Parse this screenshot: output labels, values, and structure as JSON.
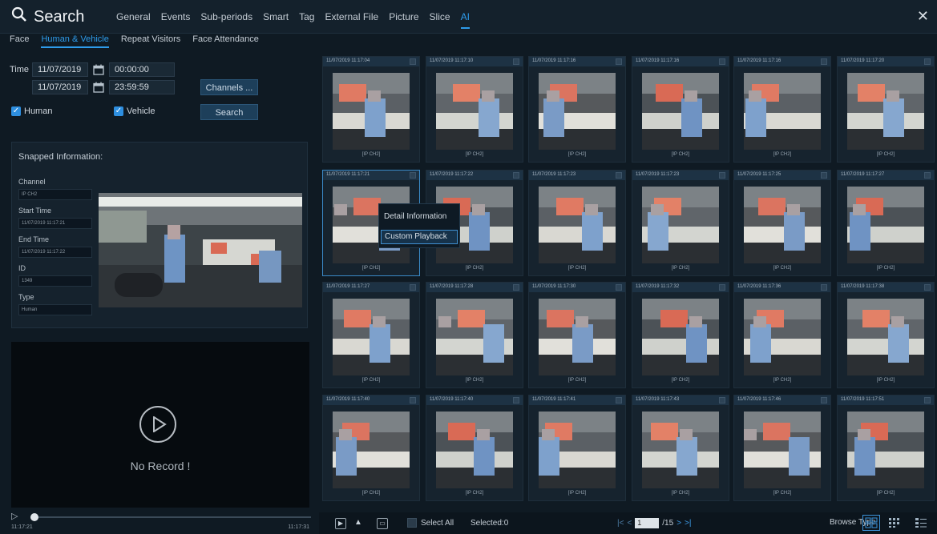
{
  "header": {
    "title": "Search",
    "tabs": [
      "General",
      "Events",
      "Sub-periods",
      "Smart",
      "Tag",
      "External File",
      "Picture",
      "Slice",
      "AI"
    ],
    "active_tab": "AI"
  },
  "subtabs": {
    "items": [
      "Face",
      "Human & Vehicle",
      "Repeat Visitors",
      "Face Attendance"
    ],
    "active": "Human & Vehicle"
  },
  "filters": {
    "time_label": "Time",
    "start_date": "11/07/2019",
    "start_time": "00:00:00",
    "end_date": "11/07/2019",
    "end_time": "23:59:59",
    "channels_label": "Channels ...",
    "human_label": "Human",
    "vehicle_label": "Vehicle",
    "search_label": "Search"
  },
  "snapped": {
    "title": "Snapped Information:",
    "channel_label": "Channel",
    "channel_value": "IP CH2",
    "start_label": "Start Time",
    "start_value": "11/07/2019 11:17:21",
    "end_label": "End Time",
    "end_value": "11/07/2019 11:17:22",
    "id_label": "ID",
    "id_value": "1349",
    "type_label": "Type",
    "type_value": "Human"
  },
  "player": {
    "no_record": "No Record !",
    "start_time": "11:17:21",
    "end_time": "11:17:31"
  },
  "thumbnails": [
    {
      "ts": "11/07/2019 11:17:04",
      "ch": "[IP CH2]"
    },
    {
      "ts": "11/07/2019 11:17:10",
      "ch": "[IP CH2]"
    },
    {
      "ts": "11/07/2019 11:17:16",
      "ch": "[IP CH2]"
    },
    {
      "ts": "11/07/2019 11:17:16",
      "ch": "[IP CH2]"
    },
    {
      "ts": "11/07/2019 11:17:16",
      "ch": "[IP CH2]"
    },
    {
      "ts": "11/07/2019 11:17:20",
      "ch": "[IP CH2]"
    },
    {
      "ts": "11/07/2019 11:17:21",
      "ch": "[IP CH2]"
    },
    {
      "ts": "11/07/2019 11:17:22",
      "ch": "[IP CH2]"
    },
    {
      "ts": "11/07/2019 11:17:23",
      "ch": "[IP CH2]"
    },
    {
      "ts": "11/07/2019 11:17:23",
      "ch": "[IP CH2]"
    },
    {
      "ts": "11/07/2019 11:17:25",
      "ch": "[IP CH2]"
    },
    {
      "ts": "11/07/2019 11:17:27",
      "ch": "[IP CH2]"
    },
    {
      "ts": "11/07/2019 11:17:27",
      "ch": "[IP CH2]"
    },
    {
      "ts": "11/07/2019 11:17:28",
      "ch": "[IP CH2]"
    },
    {
      "ts": "11/07/2019 11:17:30",
      "ch": "[IP CH2]"
    },
    {
      "ts": "11/07/2019 11:17:32",
      "ch": "[IP CH2]"
    },
    {
      "ts": "11/07/2019 11:17:36",
      "ch": "[IP CH2]"
    },
    {
      "ts": "11/07/2019 11:17:38",
      "ch": "[IP CH2]"
    },
    {
      "ts": "11/07/2019 11:17:40",
      "ch": "[IP CH2]"
    },
    {
      "ts": "11/07/2019 11:17:40",
      "ch": "[IP CH2]"
    },
    {
      "ts": "11/07/2019 11:17:41",
      "ch": "[IP CH2]"
    },
    {
      "ts": "11/07/2019 11:17:43",
      "ch": "[IP CH2]"
    },
    {
      "ts": "11/07/2019 11:17:46",
      "ch": "[IP CH2]"
    },
    {
      "ts": "11/07/2019 11:17:51",
      "ch": "[IP CH2]"
    }
  ],
  "context_menu": {
    "items": [
      "Detail Information",
      "Custom Playback"
    ],
    "highlighted": "Custom Playback"
  },
  "bottom": {
    "select_all": "Select All",
    "selected": "Selected:0",
    "page": "1",
    "total_pages": "/15",
    "browse_type": "Browse Type:"
  },
  "colors": {
    "accent": "#2e9bea",
    "panel": "#15222d",
    "background": "#0f1a23"
  }
}
